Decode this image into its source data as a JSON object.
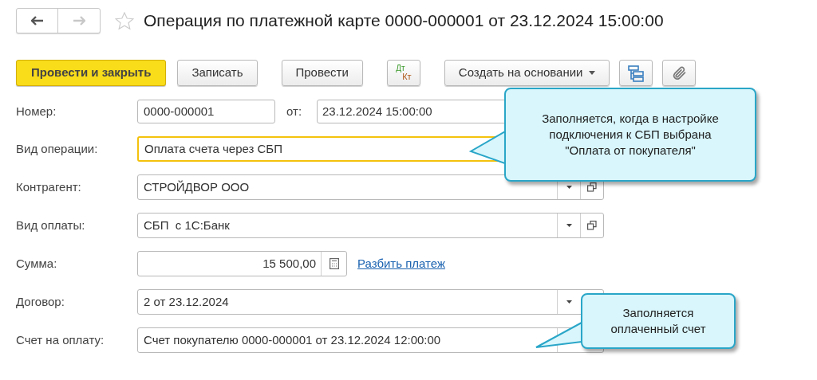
{
  "nav": {
    "back": {
      "disabled": false
    },
    "forward": {
      "disabled": true
    }
  },
  "title": "Операция по платежной карте 0000-000001 от 23.12.2024 15:00:00",
  "favorite": {
    "on": false
  },
  "toolbar": [
    {
      "kind": "primary",
      "label": "Провести и закрыть"
    },
    {
      "kind": "default",
      "label": "Записать"
    },
    {
      "kind": "default",
      "label": "Провести"
    },
    {
      "kind": "dtkt",
      "top": "Дт",
      "bottom": "Кт"
    },
    {
      "kind": "menu",
      "label": "Создать на основании"
    },
    {
      "kind": "structure"
    },
    {
      "kind": "attach"
    }
  ],
  "fields": [
    {
      "kind": "number",
      "label": "Номер:",
      "value": "0000-000001",
      "focused": false,
      "date_label": "от:",
      "date_value": "23.12.2024 15:00:00"
    },
    {
      "kind": "select",
      "label": "Вид операции:",
      "value": "Оплата счета через СБП",
      "focused": true,
      "dropdown_button": false,
      "open_button": false
    },
    {
      "kind": "select",
      "label": "Контрагент:",
      "value": "СТРОЙДВОР ООО",
      "focused": false,
      "dropdown_button": true,
      "open_button": true
    },
    {
      "kind": "select",
      "label": "Вид оплаты:",
      "value": "СБП  с 1С:Банк",
      "focused": false,
      "dropdown_button": true,
      "open_button": true
    },
    {
      "kind": "amount",
      "label": "Сумма:",
      "value": "15 500,00",
      "focused": false,
      "link": "Разбить платеж"
    },
    {
      "kind": "select",
      "label": "Договор:",
      "value": "2 от 23.12.2024",
      "focused": false,
      "dropdown_button": true,
      "open_button": false
    },
    {
      "kind": "select",
      "label": "Счет на оплату:",
      "value": "Счет покупателю 0000-000001 от 23.12.2024 12:00:00",
      "focused": false,
      "dropdown_button": true,
      "open_button": false
    }
  ],
  "callouts": [
    {
      "kind": "left",
      "text": "Заполняется, когда в настройке подключения к СБП выбрана \"Оплата от покупателя\""
    },
    {
      "kind": "bottom-left",
      "text": "Заполняется оплаченный счет"
    }
  ]
}
